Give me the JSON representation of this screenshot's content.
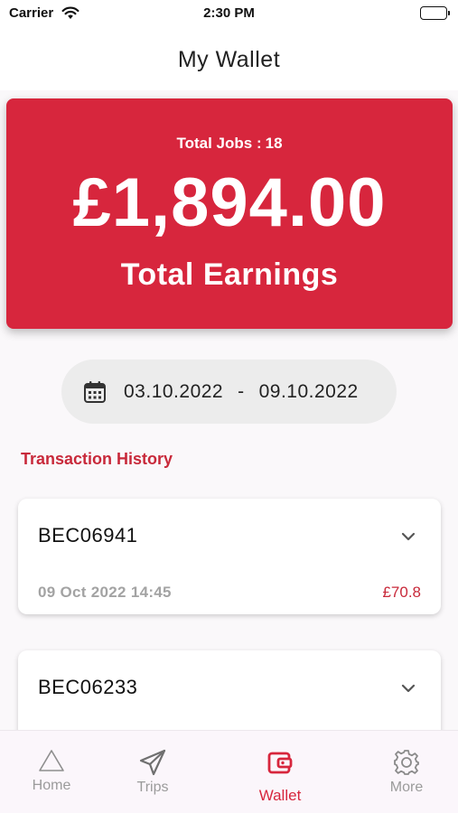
{
  "status_bar": {
    "carrier": "Carrier",
    "time": "2:30 PM"
  },
  "header": {
    "title": "My Wallet"
  },
  "earnings": {
    "jobs_label": "Total Jobs :",
    "jobs_count": "18",
    "amount": "£1,894.00",
    "label": "Total Earnings",
    "card_color": "#d7263d"
  },
  "date_range": {
    "start": "03.10.2022",
    "separator": "-",
    "end": "09.10.2022",
    "icon": "calendar-icon"
  },
  "transactions": {
    "title": "Transaction History",
    "items": [
      {
        "id": "BEC06941",
        "date": "09 Oct 2022 14:45",
        "amount": "£70.8",
        "icon": "chevron-down-icon"
      },
      {
        "id": "BEC06233",
        "icon": "chevron-down-icon"
      }
    ]
  },
  "tabs": [
    {
      "label": "Home",
      "icon": "triangle-home-icon",
      "active": false
    },
    {
      "label": "Trips",
      "icon": "paper-plane-icon",
      "active": false
    },
    {
      "label": "Wallet",
      "icon": "wallet-icon",
      "active": true
    },
    {
      "label": "More",
      "icon": "gear-icon",
      "active": false
    }
  ],
  "colors": {
    "accent": "#d7263d",
    "inactive_tab": "#9b9b9b"
  }
}
